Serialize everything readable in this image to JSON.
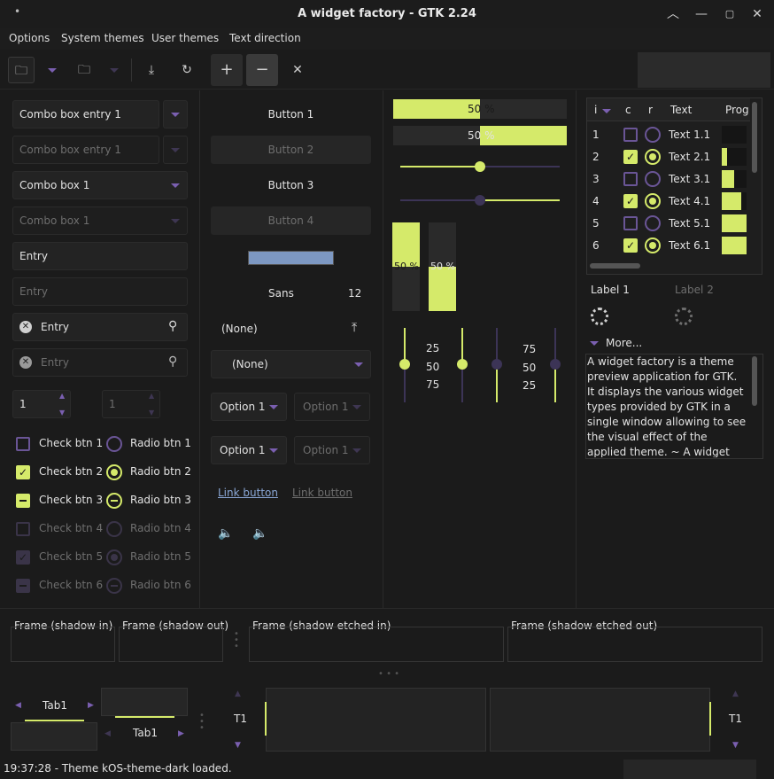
{
  "window": {
    "title": "A widget factory - GTK 2.24",
    "menu_dot": "•"
  },
  "menu": [
    "Options",
    "System themes",
    "User themes",
    "Text direction"
  ],
  "combos": {
    "entry1": "Combo box entry 1",
    "entry1_dis": "Combo box entry 1",
    "box1": "Combo box 1",
    "box1_dis": "Combo box 1"
  },
  "entries": {
    "entry": "Entry",
    "entry_dis": "Entry",
    "search1": "Entry",
    "search2": "Entry"
  },
  "spins": {
    "a": "1",
    "b": "1"
  },
  "checks": [
    "Check btn 1",
    "Check btn 2",
    "Check btn 3",
    "Check btn 4",
    "Check btn 5",
    "Check btn 6"
  ],
  "radios": [
    "Radio btn 1",
    "Radio btn 2",
    "Radio btn 3",
    "Radio btn 4",
    "Radio btn 5",
    "Radio btn 6"
  ],
  "buttons": [
    "Button 1",
    "Button 2",
    "Button 3",
    "Button 4"
  ],
  "font": {
    "name": "Sans",
    "size": "12"
  },
  "file_chooser": "(None)",
  "combo_none": "(None)",
  "options": [
    "Option 1",
    "Option 1",
    "Option 1",
    "Option 1"
  ],
  "links": [
    "Link button",
    "Link button"
  ],
  "progress": {
    "h1": "50 %",
    "h2": "50 %",
    "v1": "50 %",
    "v2": "50 %",
    "fraction": 0.5
  },
  "scale_marks": [
    "25",
    "50",
    "75"
  ],
  "scale_marks2": [
    "75",
    "50",
    "25"
  ],
  "tree": {
    "headers": [
      "i",
      "c",
      "r",
      "Text",
      "Prog"
    ],
    "rows": [
      {
        "i": "1",
        "t": "Text 1.1"
      },
      {
        "i": "2",
        "t": "Text 2.1"
      },
      {
        "i": "3",
        "t": "Text 3.1"
      },
      {
        "i": "4",
        "t": "Text 4.1"
      },
      {
        "i": "5",
        "t": "Text 5.1"
      },
      {
        "i": "6",
        "t": "Text 6.1"
      }
    ]
  },
  "labels": {
    "l1": "Label 1",
    "l2": "Label 2",
    "more": "More..."
  },
  "textview": "A widget factory is a theme preview application for GTK. It displays the various widget types provided by GTK in a single window allowing to see the visual effect of the applied theme. ~ A widget factory is a",
  "frames": [
    "Frame (shadow in)",
    "Frame (shadow out)",
    "Frame (shadow etched in)",
    "Frame (shadow etched out)"
  ],
  "tabs": {
    "t1": "Tab1",
    "t2": "Tab1",
    "t3": "T1",
    "t4": "T1"
  },
  "status": "19:37:28 - Theme kOS-theme-dark loaded.",
  "colors": {
    "accent": "#d5ea6a",
    "purple": "#6a5596",
    "bg": "#1b1b1b"
  }
}
